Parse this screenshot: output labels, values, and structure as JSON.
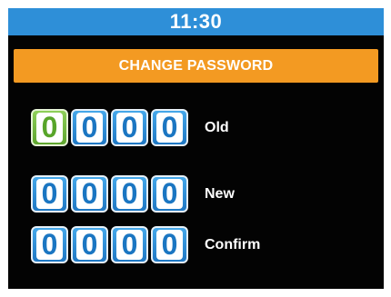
{
  "status_bar": {
    "time": "11:30"
  },
  "header": {
    "title": "CHANGE PASSWORD"
  },
  "rows": [
    {
      "label": "Old",
      "digits": [
        "0",
        "0",
        "0",
        "0"
      ],
      "active_index": 0
    },
    {
      "label": "New",
      "digits": [
        "0",
        "0",
        "0",
        "0"
      ]
    },
    {
      "label": "Confirm",
      "digits": [
        "0",
        "0",
        "0",
        "0"
      ]
    }
  ],
  "colors": {
    "status_bar": "#2e8fd8",
    "title_bar": "#f39a22",
    "digit_box": "#2a8ad6",
    "active_digit_box": "#7bbf45",
    "background": "#030303"
  }
}
